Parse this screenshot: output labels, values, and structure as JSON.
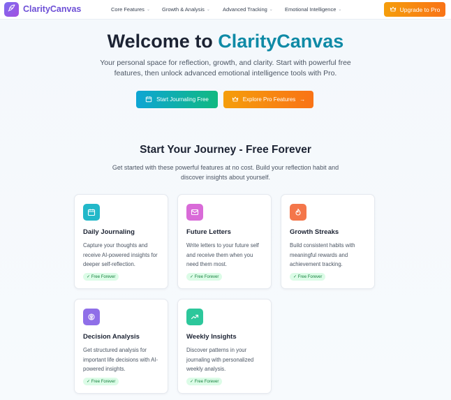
{
  "brand": {
    "name": "ClarityCanvas",
    "logo_icon": "feather-pen-icon",
    "logo_color": "#7c6cf0"
  },
  "nav": {
    "items": [
      {
        "label": "Core Features"
      },
      {
        "label": "Growth & Analysis"
      },
      {
        "label": "Advanced Tracking"
      },
      {
        "label": "Emotional Intelligence"
      }
    ],
    "upgrade_label": "Upgrade to Pro"
  },
  "hero": {
    "title_prefix": "Welcome to ",
    "title_accent": "ClarityCanvas",
    "subtitle": "Your personal space for reflection, growth, and clarity. Start with powerful free features, then unlock advanced emotional intelligence tools with Pro.",
    "start_label": "Start Journaling Free",
    "pro_label": "Explore Pro Features"
  },
  "section": {
    "title": "Start Your Journey - Free Forever",
    "subtitle": "Get started with these powerful features at no cost. Build your reflection habit and discover insights about yourself."
  },
  "cards": [
    {
      "title": "Daily Journaling",
      "desc": "Capture your thoughts and receive AI-powered insights for deeper self-reflection.",
      "badge": "✓ Free Forever",
      "icon": "calendar-icon",
      "color": "#22b8c9"
    },
    {
      "title": "Future Letters",
      "desc": "Write letters to your future self and receive them when you need them most.",
      "badge": "✓ Free Forever",
      "icon": "mail-icon",
      "color": "#d96bd8"
    },
    {
      "title": "Growth Streaks",
      "desc": "Build consistent habits with meaningful rewards and achievement tracking.",
      "badge": "✓ Free Forever",
      "icon": "flame-icon",
      "color": "#f4764a"
    },
    {
      "title": "Decision Analysis",
      "desc": "Get structured analysis for important life decisions with AI-powered insights.",
      "badge": "✓ Free Forever",
      "icon": "brain-icon",
      "color": "#8f6fe8"
    },
    {
      "title": "Weekly Insights",
      "desc": "Discover patterns in your journaling with personalized weekly analysis.",
      "badge": "✓ Free Forever",
      "icon": "trending-up-icon",
      "color": "#2cc79b"
    }
  ],
  "colors": {
    "accent_teal": "#0f8aa6",
    "orange": "#f97316",
    "badge_green": "#15803d"
  }
}
